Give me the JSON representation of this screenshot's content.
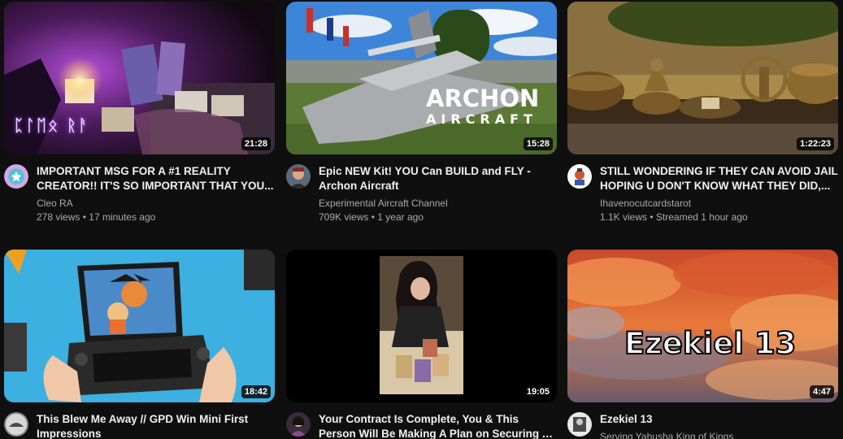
{
  "videos": [
    {
      "title": "IMPORTANT MSG FOR A #1 REALITY CREATOR!! IT'S SO IMPORTANT THAT YOU...",
      "channel": "Cleo RA",
      "views": "278 views",
      "age": "17 minutes ago",
      "duration": "21:28",
      "thumb_text": "ᛈᛚᛖᛟ ᚱᚨ"
    },
    {
      "title": "Epic NEW Kit! YOU Can BUILD and FLY - Archon Aircraft",
      "channel": "Experimental Aircraft Channel",
      "views": "709K views",
      "age": "1 year ago",
      "duration": "15:28",
      "thumb_text": "ARCHON",
      "thumb_subtext": "AIRCRAFT"
    },
    {
      "title": "STILL WONDERING IF THEY CAN AVOID JAIL HOPING U DON'T KNOW WHAT THEY DID,...",
      "channel": "Ihavenocutcardstarot",
      "views": "1.1K views",
      "age": "Streamed 1 hour ago",
      "duration": "1:22:23"
    },
    {
      "title": "This Blew Me Away // GPD Win Mini First Impressions",
      "channel": "",
      "views": "",
      "age": "",
      "duration": "18:42"
    },
    {
      "title": "Your Contract Is Complete, You & This Person Will Be Making A Plan on Securing A Victory",
      "channel": "",
      "views": "",
      "age": "",
      "duration": "19:05"
    },
    {
      "title": "Ezekiel 13",
      "channel": "Serving Yahusha King of Kings",
      "views": "",
      "age": "",
      "duration": "4:47",
      "thumb_text": "Ezekiel 13"
    }
  ],
  "separator": "•",
  "icons": {
    "avatars": [
      "cleo-avatar-icon",
      "experimental-aircraft-avatar-icon",
      "ihavenocutcardstarot-avatar-icon",
      "gpd-channel-avatar-icon",
      "tarot-reader-avatar-icon",
      "serving-yahusha-avatar-icon"
    ]
  },
  "colors": {
    "background": "#0f0f0f",
    "title": "#f1f1f1",
    "secondary": "#aaaaaa"
  }
}
